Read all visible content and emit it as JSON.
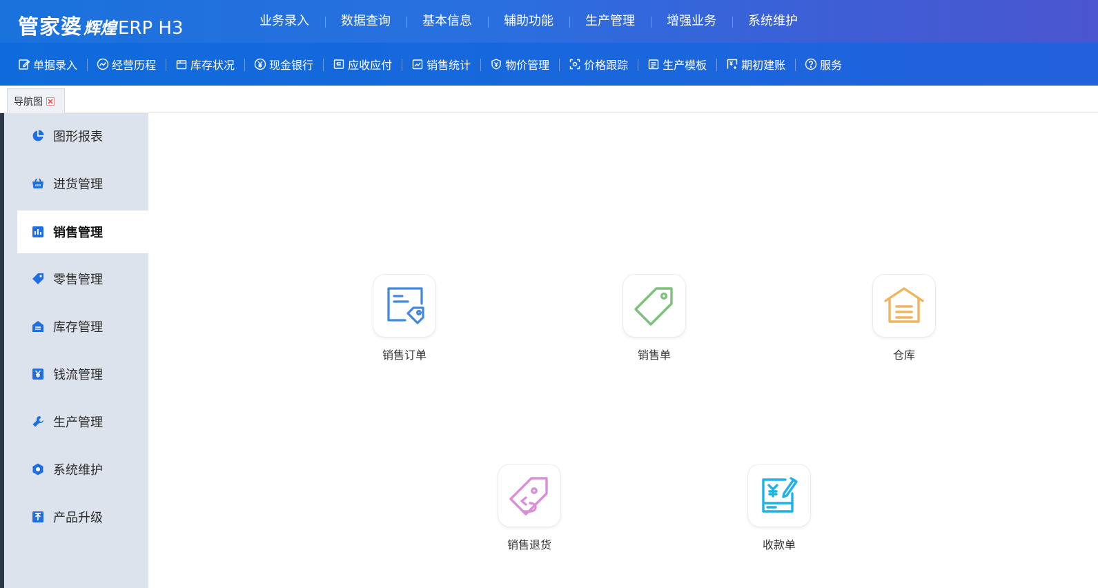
{
  "header": {
    "brand": "管家婆",
    "sub_brand": "辉煌",
    "product": "ERP H3",
    "menu": [
      "业务录入",
      "数据查询",
      "基本信息",
      "辅助功能",
      "生产管理",
      "增强业务",
      "系统维护"
    ]
  },
  "toolbar": {
    "items": [
      {
        "label": "单据录入",
        "icon": "edit-icon"
      },
      {
        "label": "经营历程",
        "icon": "trend-icon"
      },
      {
        "label": "库存状况",
        "icon": "box-icon"
      },
      {
        "label": "现金银行",
        "icon": "yuan-circle-icon"
      },
      {
        "label": "应收应付",
        "icon": "ledger-icon"
      },
      {
        "label": "销售统计",
        "icon": "chart-icon"
      },
      {
        "label": "物价管理",
        "icon": "shield-yuan-icon"
      },
      {
        "label": "价格跟踪",
        "icon": "target-icon"
      },
      {
        "label": "生产模板",
        "icon": "template-icon"
      },
      {
        "label": "期初建账",
        "icon": "account-icon"
      },
      {
        "label": "服务",
        "icon": "help-icon"
      }
    ]
  },
  "tabs": [
    {
      "label": "导航图",
      "active": true
    }
  ],
  "sidebar": {
    "items": [
      {
        "label": "图形报表",
        "icon": "pie-chart-icon",
        "active": false
      },
      {
        "label": "进货管理",
        "icon": "basket-icon",
        "active": false
      },
      {
        "label": "销售管理",
        "icon": "bar-chart-icon",
        "active": true
      },
      {
        "label": "零售管理",
        "icon": "tag-icon",
        "active": false
      },
      {
        "label": "库存管理",
        "icon": "warehouse-icon",
        "active": false
      },
      {
        "label": "钱流管理",
        "icon": "yuan-icon",
        "active": false
      },
      {
        "label": "生产管理",
        "icon": "wrench-icon",
        "active": false
      },
      {
        "label": "系统维护",
        "icon": "hexagon-icon",
        "active": false
      },
      {
        "label": "产品升级",
        "icon": "upgrade-icon",
        "active": false
      }
    ]
  },
  "content": {
    "tiles": [
      {
        "label": "销售订单",
        "icon": "sales-order-icon",
        "color": "#3f87e0"
      },
      {
        "label": "销售单",
        "icon": "sales-tag-icon",
        "color": "#7cc07a"
      },
      {
        "label": "仓库",
        "icon": "warehouse-house-icon",
        "color": "#eeb45e"
      },
      {
        "label": "销售退货",
        "icon": "sales-return-icon",
        "color": "#d98fd6"
      },
      {
        "label": "收款单",
        "icon": "receipt-icon",
        "color": "#1cb4e6"
      }
    ]
  },
  "colors": {
    "header_start": "#1a72dc",
    "header_end": "#4a55cf",
    "toolbar": "#1566dc",
    "sidebar_bg": "#dde3ec",
    "sidebar_icon": "#1f6fe0"
  }
}
